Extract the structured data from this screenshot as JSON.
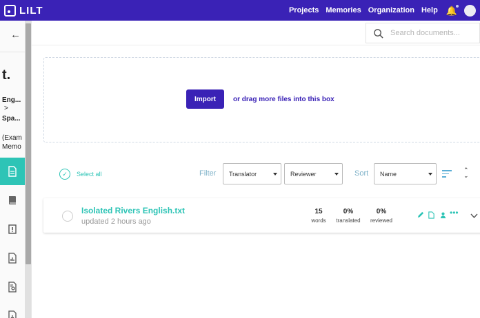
{
  "app": {
    "logo": "LILT"
  },
  "nav": {
    "items": [
      "Projects",
      "Memories",
      "Organization",
      "Help"
    ]
  },
  "search": {
    "placeholder": "Search documents..."
  },
  "project": {
    "initial": "t.",
    "source_lang": "Eng...",
    "arrow": ">",
    "target_lang": "Spa...",
    "memory_line1": "(Exam",
    "memory_line2": "Memo"
  },
  "dropzone": {
    "import_label": "Import",
    "drag_text": "or drag more files into this box"
  },
  "toolbar": {
    "select_all": "Select all",
    "filter_label": "Filter",
    "translator_value": "Translator",
    "reviewer_value": "Reviewer",
    "sort_label": "Sort",
    "sort_value": "Name"
  },
  "documents": [
    {
      "name": "Isolated Rivers English.txt",
      "updated": "updated 2 hours ago",
      "words_value": "15",
      "words_label": "words",
      "translated_value": "0%",
      "translated_label": "translated",
      "reviewed_value": "0%",
      "reviewed_label": "reviewed"
    }
  ],
  "colors": {
    "brand": "#3a22b6",
    "accent": "#2ec4b6",
    "muted_label": "#7fb2c9"
  },
  "icons": [
    "bell-icon",
    "search-icon",
    "back-arrow-icon",
    "document-icon",
    "book-icon",
    "alert-book-icon",
    "chart-doc-icon",
    "settings-doc-icon",
    "pencil-icon",
    "file-icon",
    "user-icon",
    "more-icon",
    "chevron-down-icon",
    "sort-icon",
    "up-down-icon"
  ]
}
